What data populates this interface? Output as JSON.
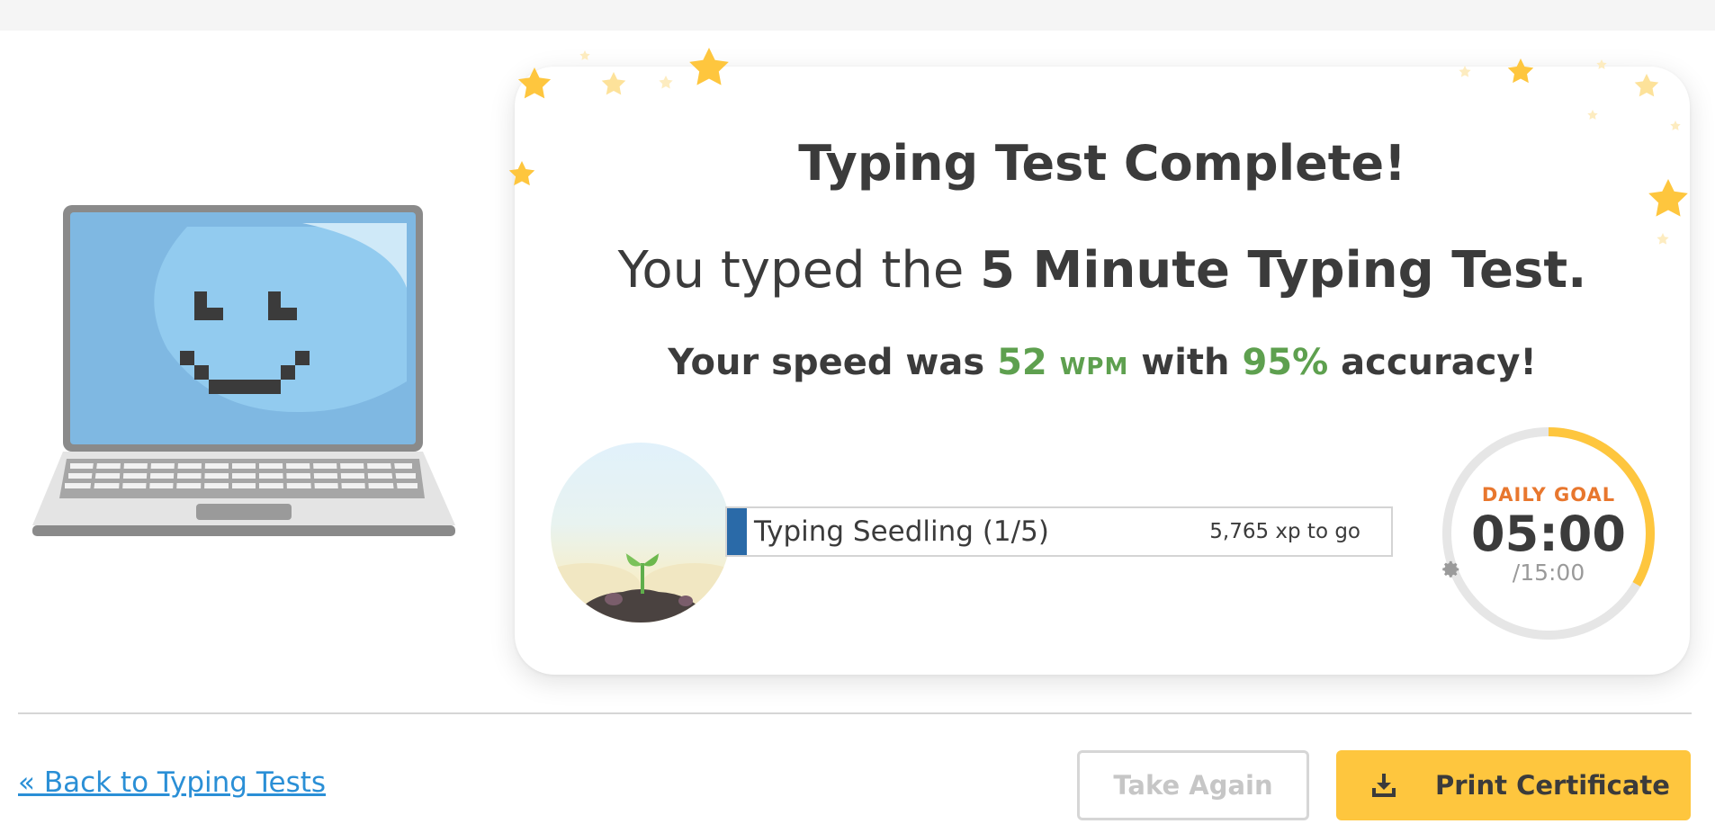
{
  "result": {
    "title": "Typing Test Complete!",
    "typed_prefix": "You typed the ",
    "test_name": "5 Minute Typing Test.",
    "speed_prefix": "Your speed was ",
    "wpm_value": "52",
    "wpm_unit": "WPM",
    "speed_mid": " with ",
    "accuracy": "95%",
    "speed_suffix": " accuracy!"
  },
  "level": {
    "name": "Typing Seedling (1/5)",
    "xp_remaining": "5,765 xp to go",
    "progress_fraction": 0.03,
    "bar_color": "#2a6aa8"
  },
  "daily_goal": {
    "label": "DAILY GOAL",
    "time": "05:00",
    "total": "/15:00",
    "progress_fraction": 0.3333,
    "ring_color": "#fec63e",
    "track_color": "#e6e6e6",
    "settings_icon": "gear-icon"
  },
  "footer": {
    "back_link": "« Back to Typing Tests",
    "take_again": "Take Again",
    "print_certificate": "Print Certificate",
    "print_icon": "download-icon"
  },
  "colors": {
    "accent_green": "#5ea04f",
    "goal_orange": "#e8772e",
    "button_yellow": "#fec63e",
    "link_blue": "#2a8fd6"
  }
}
